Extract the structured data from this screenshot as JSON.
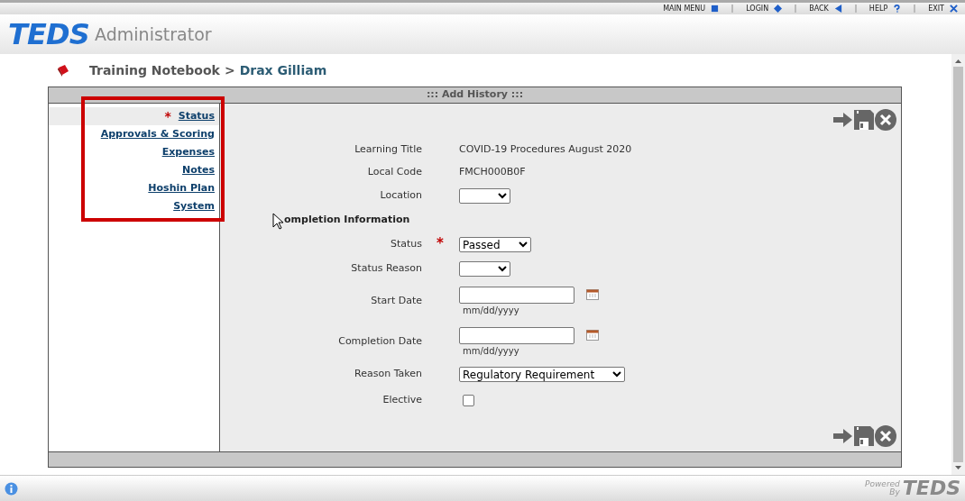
{
  "top_menu": [
    {
      "label": "MAIN MENU",
      "kind": "square"
    },
    {
      "label": "LOGIN",
      "kind": "diamond"
    },
    {
      "label": "BACK",
      "kind": "back"
    },
    {
      "label": "HELP",
      "kind": "help"
    },
    {
      "label": "EXIT",
      "kind": "exit"
    }
  ],
  "logo": "TEDS",
  "app_title": "Administrator",
  "breadcrumb": {
    "notebook": "Training Notebook",
    "separator": ">",
    "person": "Drax Gilliam"
  },
  "panel_title": "::: Add History :::",
  "sidebar": {
    "items": [
      {
        "label": "Status",
        "required_mark": "*",
        "selected": true
      },
      {
        "label": "Approvals & Scoring",
        "selected": false
      },
      {
        "label": "Expenses",
        "selected": false
      },
      {
        "label": "Notes",
        "selected": false
      },
      {
        "label": "Hoshin Plan",
        "selected": false
      },
      {
        "label": "System",
        "selected": false
      }
    ]
  },
  "form": [
    {
      "kind": "text",
      "label": "Learning Title",
      "value": "COVID-19 Procedures August 2020"
    },
    {
      "kind": "text",
      "label": "Local Code",
      "value": "FMCH000B0F"
    },
    {
      "kind": "select",
      "label": "Location"
    },
    {
      "kind": "section",
      "label": "ompletion Information"
    },
    {
      "kind": "select",
      "label": "Status",
      "required_mark": "*",
      "value": "Passed"
    },
    {
      "kind": "select",
      "label": "Status Reason"
    },
    {
      "kind": "date",
      "label": "Start Date",
      "hint": "mm/dd/yyyy"
    },
    {
      "kind": "date",
      "label": "Completion Date",
      "hint": "mm/dd/yyyy"
    },
    {
      "kind": "select",
      "label": "Reason Taken",
      "value": "Regulatory Requirement"
    },
    {
      "kind": "checkbox",
      "label": "Elective",
      "checked": false
    }
  ],
  "footer": {
    "powered": "Powered",
    "by": "By",
    "logo": "TEDS"
  }
}
